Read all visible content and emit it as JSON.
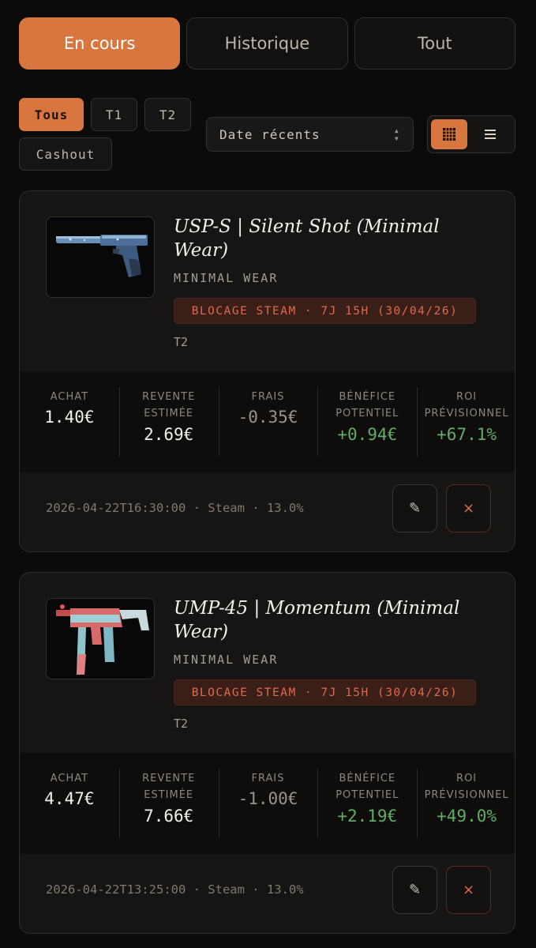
{
  "tabs": [
    {
      "label": "En cours",
      "active": true
    },
    {
      "label": "Historique",
      "active": false
    },
    {
      "label": "Tout",
      "active": false
    }
  ],
  "filters": [
    {
      "label": "Tous",
      "active": true
    },
    {
      "label": "T1",
      "active": false
    },
    {
      "label": "T2",
      "active": false
    },
    {
      "label": "Cashout",
      "active": false
    }
  ],
  "sort": {
    "selected": "Date récents"
  },
  "view_toggle": {
    "grid_icon": "grid-icon",
    "list_icon": "list-icon",
    "active": "grid"
  },
  "colors": {
    "accent": "#d7773f",
    "positive": "#5fae64",
    "danger": "#e0694a"
  },
  "stat_labels": {
    "achat": "ACHAT",
    "revente_1": "REVENTE",
    "revente_2": "ESTIMÉE",
    "frais": "FRAIS",
    "benefice_1": "BÉNÉFICE",
    "benefice_2": "POTENTIEL",
    "roi_1": "ROI",
    "roi_2": "PRÉVISIONNEL"
  },
  "items": [
    {
      "name": "USP-S | Silent Shot (Minimal Wear)",
      "wear": "MINIMAL WEAR",
      "lock": "BLOCAGE STEAM · 7J 15H (30/04/26)",
      "tier": "T2",
      "achat": "1.40€",
      "revente": "2.69€",
      "frais": "-0.35€",
      "benefice": "+0.94€",
      "roi": "+67.1%",
      "meta": "2026-04-22T16:30:00 · Steam · 13.0%"
    },
    {
      "name": "UMP-45 | Momentum (Minimal Wear)",
      "wear": "MINIMAL WEAR",
      "lock": "BLOCAGE STEAM · 7J 15H (30/04/26)",
      "tier": "T2",
      "achat": "4.47€",
      "revente": "7.66€",
      "frais": "-1.00€",
      "benefice": "+2.19€",
      "roi": "+49.0%",
      "meta": "2026-04-22T13:25:00 · Steam · 13.0%"
    }
  ],
  "actions": {
    "edit_icon": "✎",
    "delete_icon": "×"
  }
}
